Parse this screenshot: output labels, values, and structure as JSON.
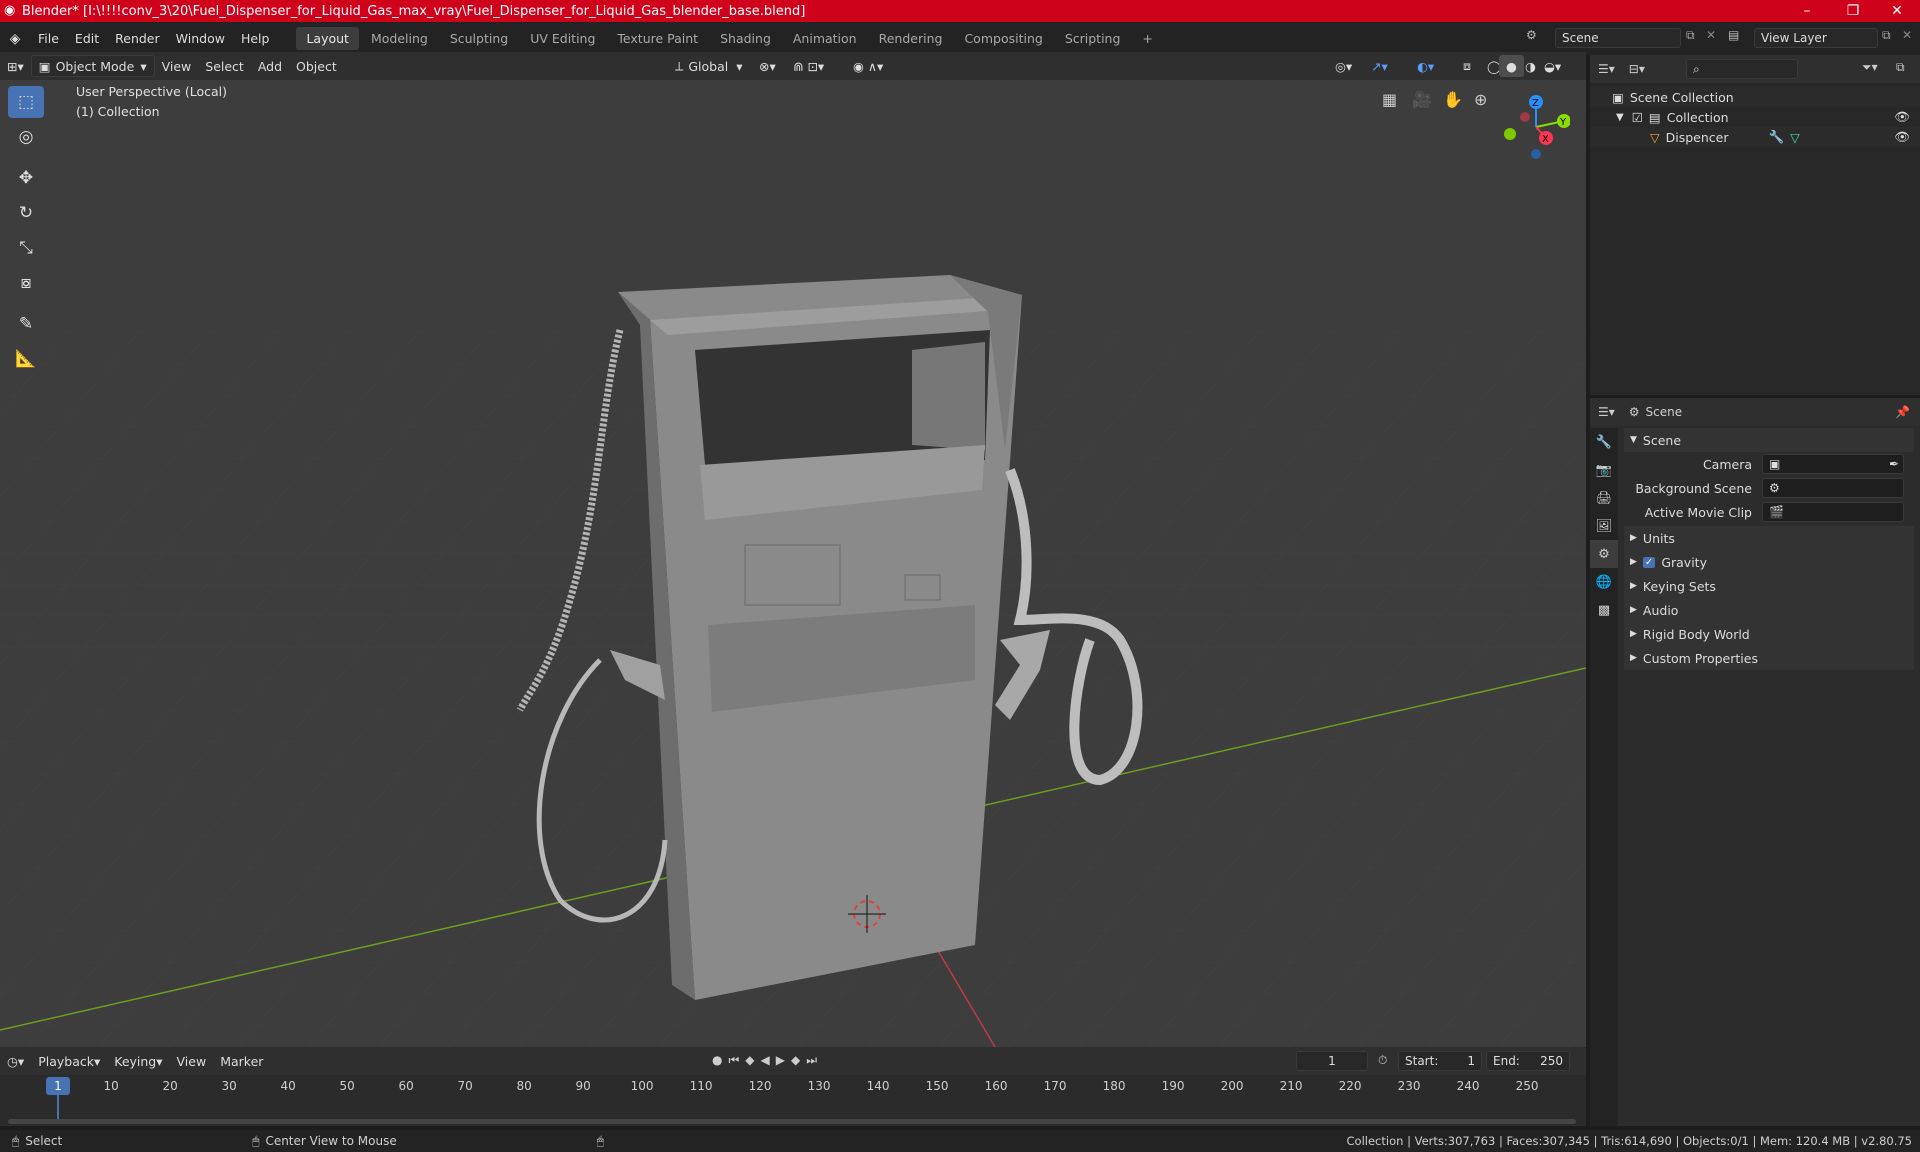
{
  "window": {
    "title": "Blender* [I:\\!!!!conv_3\\20\\Fuel_Dispenser_for_Liquid_Gas_max_vray\\Fuel_Dispenser_for_Liquid_Gas_blender_base.blend]",
    "minimize": "–",
    "restore": "❐",
    "close": "✕"
  },
  "menus": [
    "File",
    "Edit",
    "Render",
    "Window",
    "Help"
  ],
  "workspaces": [
    "Layout",
    "Modeling",
    "Sculpting",
    "UV Editing",
    "Texture Paint",
    "Shading",
    "Animation",
    "Rendering",
    "Compositing",
    "Scripting"
  ],
  "add_workspace": "+",
  "scene_field": "Scene",
  "viewlayer_field": "View Layer",
  "viewport_header": {
    "mode": "Object Mode",
    "menus": [
      "View",
      "Select",
      "Add",
      "Object"
    ],
    "orientation": "Global"
  },
  "viewport": {
    "perspective": "User Perspective (Local)",
    "collection": "(1) Collection",
    "gizmo": {
      "z": "Z",
      "y": "Y",
      "x": "X"
    }
  },
  "outliner": {
    "root": "Scene Collection",
    "collection": "Collection",
    "object": "Dispencer"
  },
  "properties": {
    "header": "Scene",
    "panel": "Scene",
    "camera_label": "Camera",
    "bg_label": "Background Scene",
    "clip_label": "Active Movie Clip",
    "sections": [
      "Units",
      "Gravity",
      "Keying Sets",
      "Audio",
      "Rigid Body World",
      "Custom Properties"
    ]
  },
  "timeline": {
    "menus": [
      "Playback",
      "Keying",
      "View",
      "Marker"
    ],
    "current_frame": "1",
    "start_label": "Start:",
    "start": "1",
    "end_label": "End:",
    "end": "250",
    "ticks": [
      "1",
      "10",
      "20",
      "30",
      "40",
      "50",
      "60",
      "70",
      "80",
      "90",
      "100",
      "110",
      "120",
      "130",
      "140",
      "150",
      "160",
      "170",
      "180",
      "190",
      "200",
      "210",
      "220",
      "230",
      "240",
      "250"
    ]
  },
  "statusbar": {
    "left": "Select",
    "middle": "Center View to Mouse",
    "right": "Collection | Verts:307,763 | Faces:307,345 | Tris:614,690 | Objects:0/1 | Mem: 120.4 MB | v2.80.75"
  },
  "colors": {
    "accent": "#4772b3",
    "titlebar": "#d0021b",
    "x_axis": "#ff3352",
    "y_axis": "#8bdc00",
    "z_axis": "#2890ff"
  }
}
